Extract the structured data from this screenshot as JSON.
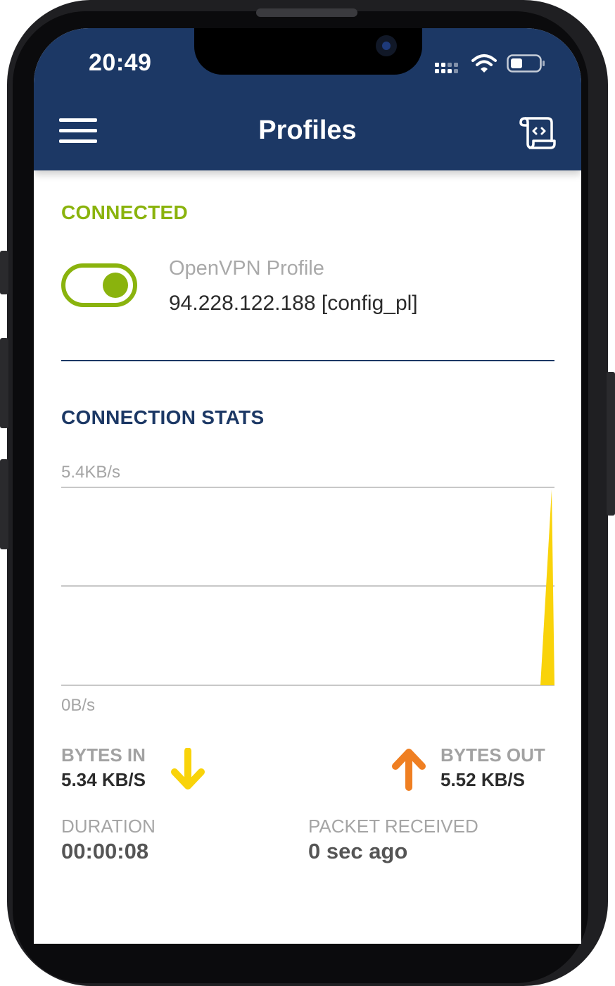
{
  "status_bar": {
    "time": "20:49"
  },
  "header": {
    "title": "Profiles",
    "bg_color": "#1c3865"
  },
  "connection": {
    "status": "CONNECTED",
    "status_color": "#8ab30d",
    "toggle_on": true,
    "profile_type": "OpenVPN Profile",
    "profile_address": "94.228.122.188 [config_pl]"
  },
  "stats": {
    "heading": "CONNECTION STATS",
    "heading_color": "#1c3865",
    "y_max_label": "5.4KB/s",
    "y_min_label": "0B/s",
    "bytes_in_label": "BYTES IN",
    "bytes_in_value": "5.34 KB/S",
    "bytes_out_label": "BYTES OUT",
    "bytes_out_value": "5.52 KB/S",
    "duration_label": "DURATION",
    "duration_value": "00:00:08",
    "packet_label": "PACKET RECEIVED",
    "packet_value": "0 sec ago",
    "in_arrow_color": "#f9d30a",
    "out_arrow_color": "#ef7f22"
  },
  "chart_data": {
    "type": "area",
    "ylim": [
      0,
      5.4
    ],
    "ylabel_max": "5.4KB/s",
    "ylabel_min": "0B/s",
    "series": [
      {
        "color": "#f9d30a",
        "values": [
          0,
          0,
          0,
          0,
          0,
          0,
          0,
          5.34
        ]
      }
    ]
  }
}
